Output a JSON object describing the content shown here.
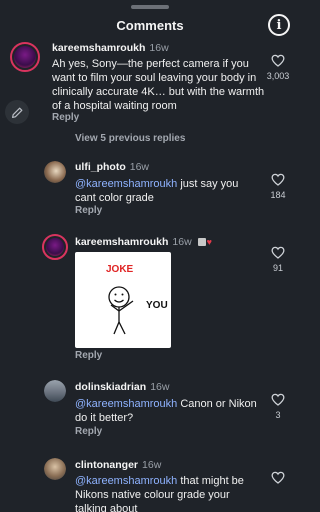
{
  "header": {
    "title": "Comments",
    "info_glyph": "i"
  },
  "icons": {
    "heart": "heart-outline-icon",
    "info": "info-circle-icon",
    "edit": "pencil-edit-icon"
  },
  "colors": {
    "background": "#1f2329",
    "mention": "#8fb3ff",
    "secondary_text": "#a3a8b0"
  },
  "comments": [
    {
      "username": "kareemshamroukh",
      "time": "16w",
      "text": "Ah yes, Sony—the perfect camera if you want to film your soul leaving your body in clinically accurate 4K… but with the warmth of a hospital waiting room",
      "likes": "3,003",
      "reply": "Reply"
    },
    {
      "username": "ulfi_photo",
      "time": "16w",
      "mention": "@kareemshamroukh",
      "text": " just say you cant color grade",
      "likes": "184",
      "reply": "Reply"
    },
    {
      "username": "kareemshamroukh",
      "time": "16w",
      "sticker_top": "JOKE",
      "sticker_label": "YOU",
      "likes": "91",
      "reply": "Reply"
    },
    {
      "username": "dolinskiadrian",
      "time": "16w",
      "mention": "@kareemshamroukh",
      "text": " Canon or Nikon do it better?",
      "likes": "3",
      "reply": "Reply"
    },
    {
      "username": "clintonanger",
      "time": "16w",
      "mention": "@kareemshamroukh",
      "text": " that might be Nikons native colour grade your talking about"
    }
  ],
  "thread": {
    "view_previous": "View 5 previous replies"
  }
}
